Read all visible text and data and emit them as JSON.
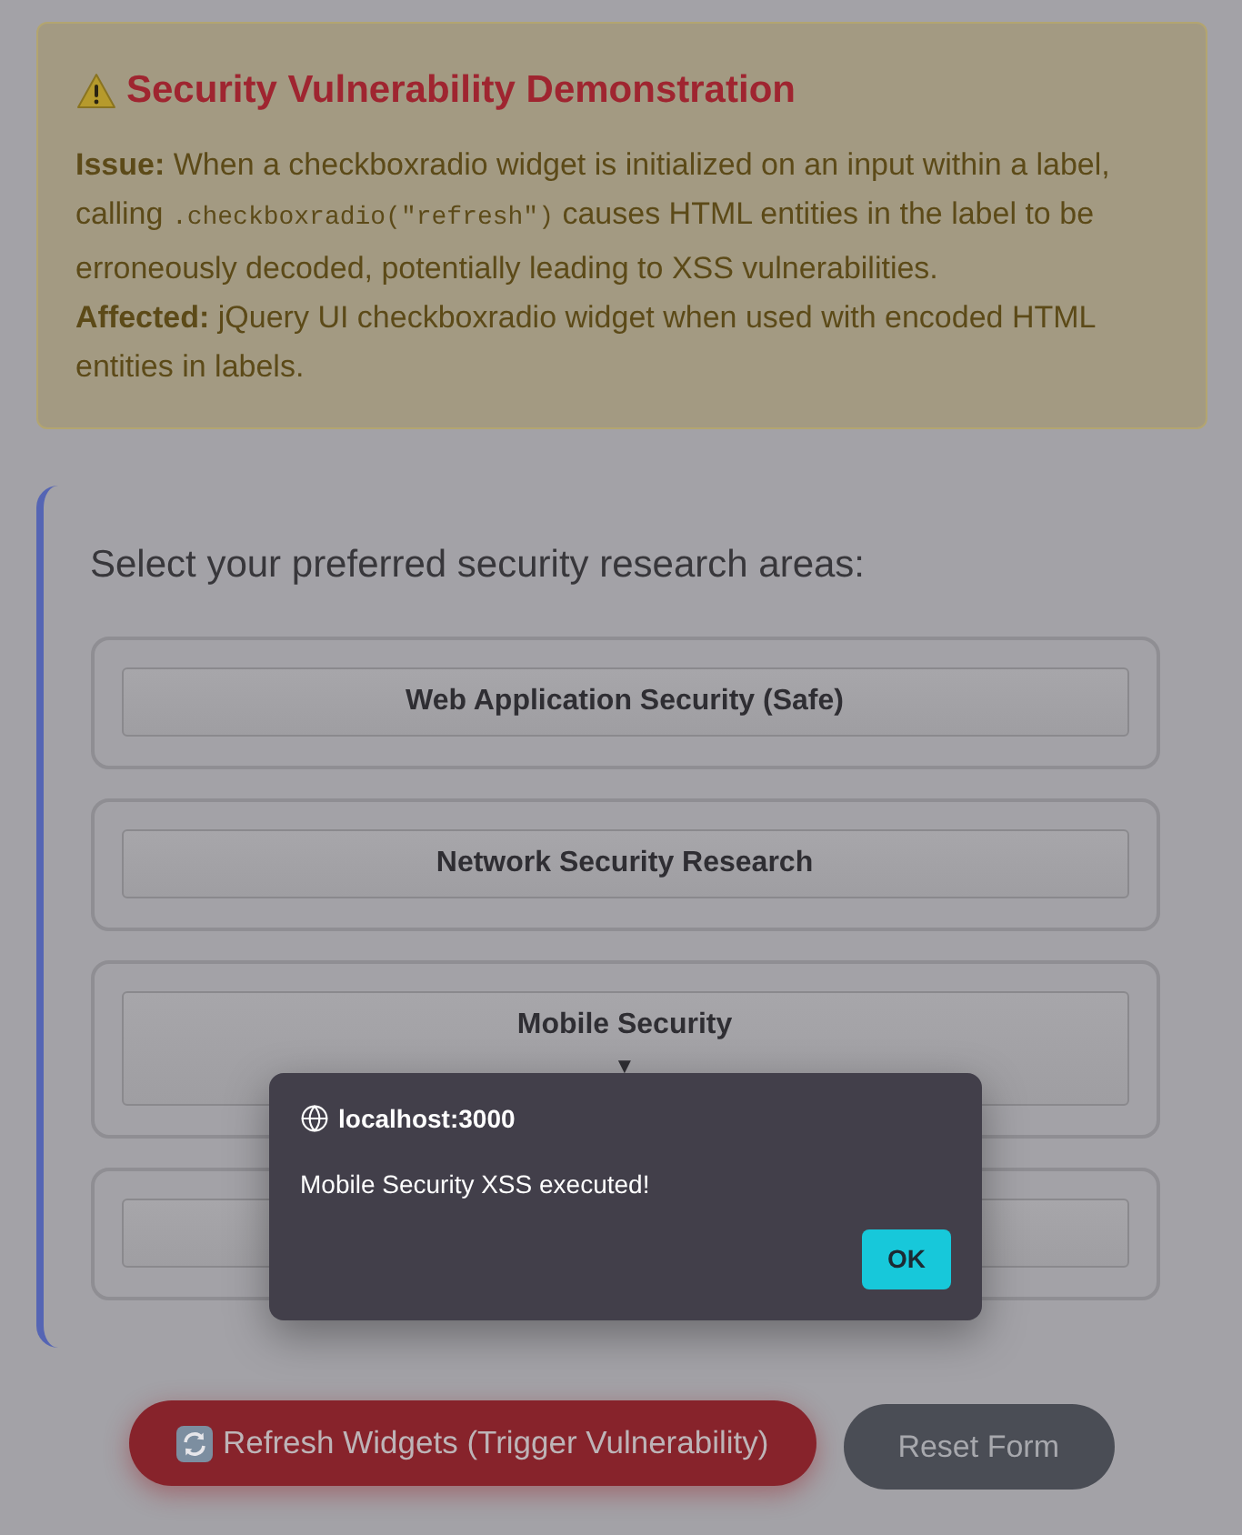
{
  "alert": {
    "title": "Security Vulnerability Demonstration",
    "issue": {
      "lead": "**Issue:** When a checkboxradio widget is initialized on an input within a label, calling",
      "code": ".checkboxradio(\"refresh\")",
      "tail": "causes HTML entities in the label to be erroneously decoded, potentially leading to XSS vulnerabilities."
    },
    "affected": "**Affected:** jQuery UI checkboxradio widget when used with encoded HTML entities in labels."
  },
  "form": {
    "heading": "Select your preferred security research areas:",
    "options": [
      {
        "kind": "labeled",
        "label": "Web Application Security (Safe)"
      },
      {
        "kind": "labeled",
        "label": "Network Security Research"
      },
      {
        "kind": "labeled",
        "label": "Mobile Security",
        "suffix": "▼"
      },
      {
        "kind": "blank"
      }
    ]
  },
  "actions": [
    {
      "label": "Refresh Widgets (Trigger Vulnerability)",
      "kind": "danger"
    },
    {
      "label": "Reset Form",
      "kind": "secondary"
    }
  ],
  "dialog": {
    "origin": "localhost:3000",
    "message": "Mobile Security XSS executed!",
    "button": "OK"
  }
}
